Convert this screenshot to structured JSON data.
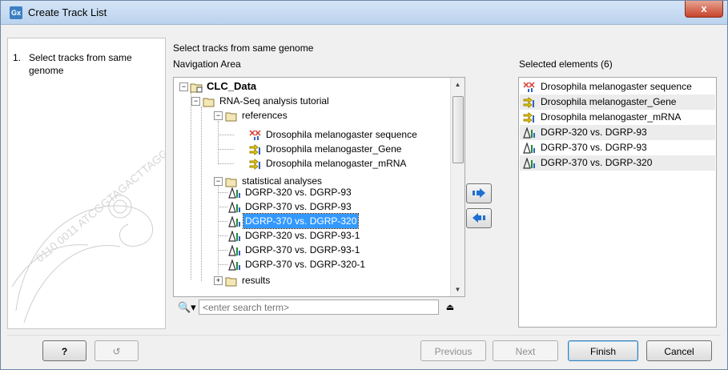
{
  "window": {
    "title": "Create Track List",
    "app_icon": "Gx",
    "close_label": "x"
  },
  "steps": [
    {
      "number": "1.",
      "label": "Select tracks from same genome"
    }
  ],
  "main": {
    "section_title": "Select tracks from same genome",
    "navigation_label": "Navigation Area",
    "selected_label": "Selected elements (6)"
  },
  "tree": {
    "root": "CLC_Data",
    "tutorial": "RNA-Seq analysis tutorial",
    "references": "references",
    "references_items": [
      {
        "label": "Drosophila melanogaster sequence",
        "icon": "sequence-track-icon"
      },
      {
        "label": "Drosophila melanogaster_Gene",
        "icon": "annotation-track-icon"
      },
      {
        "label": "Drosophila melanogaster_mRNA",
        "icon": "annotation-track-icon"
      }
    ],
    "statistical": "statistical analyses",
    "statistical_items": [
      {
        "label": "DGRP-320 vs. DGRP-93",
        "icon": "statistics-track-icon"
      },
      {
        "label": "DGRP-370 vs. DGRP-93",
        "icon": "statistics-track-icon"
      },
      {
        "label": "DGRP-370 vs. DGRP-320",
        "icon": "statistics-track-icon",
        "selected": true
      },
      {
        "label": "DGRP-320 vs. DGRP-93-1",
        "icon": "statistics-track-icon"
      },
      {
        "label": "DGRP-370 vs. DGRP-93-1",
        "icon": "statistics-track-icon"
      },
      {
        "label": "DGRP-370 vs. DGRP-320-1",
        "icon": "statistics-track-icon"
      }
    ],
    "results": "results"
  },
  "search": {
    "placeholder": "<enter search term>"
  },
  "selected_elements": [
    {
      "label": "Drosophila melanogaster sequence",
      "icon": "sequence-track-icon"
    },
    {
      "label": "Drosophila melanogaster_Gene",
      "icon": "annotation-track-icon"
    },
    {
      "label": "Drosophila melanogaster_mRNA",
      "icon": "annotation-track-icon"
    },
    {
      "label": "DGRP-320 vs. DGRP-93",
      "icon": "statistics-track-icon"
    },
    {
      "label": "DGRP-370 vs. DGRP-93",
      "icon": "statistics-track-icon"
    },
    {
      "label": "DGRP-370 vs. DGRP-320",
      "icon": "statistics-track-icon"
    }
  ],
  "buttons": {
    "help": "?",
    "previous": "Previous",
    "next": "Next",
    "finish": "Finish",
    "cancel": "Cancel"
  },
  "decoration_text": "0110 0011 ATCGGTAGACTTAGG"
}
